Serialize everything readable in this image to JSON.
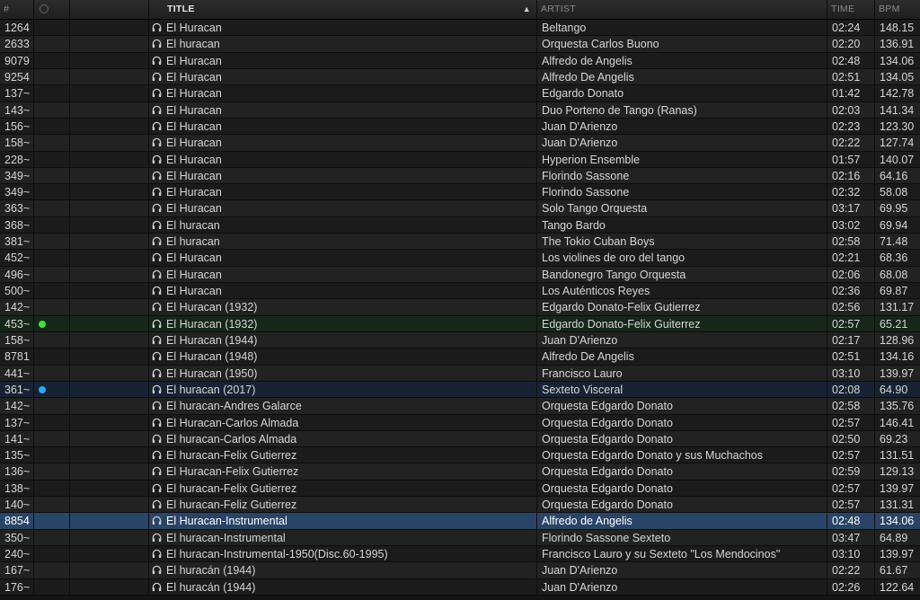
{
  "columns": {
    "num": "#",
    "title": "TITLE",
    "artist": "ARTIST",
    "time": "TIME",
    "bpm": "BPM"
  },
  "sort": {
    "column": "title",
    "direction": "ascending",
    "arrow": "▲"
  },
  "colors": {
    "green_dot": "#3fe23a",
    "blue_dot": "#27a8ee",
    "selected_row": "#2a4468"
  },
  "tracks": [
    {
      "num": "1264",
      "title": "El Huracan",
      "artist": "Beltango",
      "time": "02:24",
      "bpm": "148.15"
    },
    {
      "num": "2633",
      "title": "El huracan",
      "artist": "Orquesta Carlos Buono",
      "time": "02:20",
      "bpm": "136.91"
    },
    {
      "num": "9079",
      "title": "El Huracan",
      "artist": "Alfredo de Angelis",
      "time": "02:48",
      "bpm": "134.06"
    },
    {
      "num": "9254",
      "title": "El Huracan",
      "artist": "Alfredo De Angelis",
      "time": "02:51",
      "bpm": "134.05"
    },
    {
      "num": "137~",
      "title": "El Huracan",
      "artist": "Edgardo Donato",
      "time": "01:42",
      "bpm": "142.78"
    },
    {
      "num": "143~",
      "title": "El Huracan",
      "artist": "Duo Porteno de Tango (Ranas)",
      "time": "02:03",
      "bpm": "141.34"
    },
    {
      "num": "156~",
      "title": "El Huracan",
      "artist": "Juan D'Arienzo",
      "time": "02:23",
      "bpm": "123.30"
    },
    {
      "num": "158~",
      "title": "El Huracan",
      "artist": "Juan D'Arienzo",
      "time": "02:22",
      "bpm": "127.74"
    },
    {
      "num": "228~",
      "title": "El Huracan",
      "artist": "Hyperion Ensemble",
      "time": "01:57",
      "bpm": "140.07"
    },
    {
      "num": "349~",
      "title": "El Huracan",
      "artist": "Florindo Sassone",
      "time": "02:16",
      "bpm": "64.16"
    },
    {
      "num": "349~",
      "title": "El Huracan",
      "artist": "Florindo Sassone",
      "time": "02:32",
      "bpm": "58.08"
    },
    {
      "num": "363~",
      "title": "El Huracan",
      "artist": "Solo Tango Orquesta",
      "time": "03:17",
      "bpm": "69.95"
    },
    {
      "num": "368~",
      "title": "El huracan",
      "artist": "Tango Bardo",
      "time": "03:02",
      "bpm": "69.94"
    },
    {
      "num": "381~",
      "title": "El huracan",
      "artist": "The Tokio Cuban Boys",
      "time": "02:58",
      "bpm": "71.48"
    },
    {
      "num": "452~",
      "title": "El Huracan",
      "artist": "Los violines de oro del tango",
      "time": "02:21",
      "bpm": "68.36"
    },
    {
      "num": "496~",
      "title": "El Huracan",
      "artist": "Bandonegro Tango Orquesta",
      "time": "02:06",
      "bpm": "68.08"
    },
    {
      "num": "500~",
      "title": "El Huracan",
      "artist": "Los Auténticos Reyes",
      "time": "02:36",
      "bpm": "69.87"
    },
    {
      "num": "142~",
      "title": "El Huracan (1932)",
      "artist": "Edgardo Donato-Felix Gutierrez",
      "time": "02:56",
      "bpm": "131.17"
    },
    {
      "num": "453~",
      "title": "El Huracan (1932)",
      "artist": "Edgardo Donato-Felix Guiterrez",
      "time": "02:57",
      "bpm": "65.21",
      "marker": "green"
    },
    {
      "num": "158~",
      "title": "El Huracan (1944)",
      "artist": "Juan D'Arienzo",
      "time": "02:17",
      "bpm": "128.96"
    },
    {
      "num": "8781",
      "title": "El Huracan (1948)",
      "artist": "Alfredo De Angelis",
      "time": "02:51",
      "bpm": "134.16"
    },
    {
      "num": "441~",
      "title": "El Huracan (1950)",
      "artist": "Francisco Lauro",
      "time": "03:10",
      "bpm": "139.97"
    },
    {
      "num": "361~",
      "title": "El huracan (2017)",
      "artist": "Sexteto Visceral",
      "time": "02:08",
      "bpm": "64.90",
      "marker": "blue"
    },
    {
      "num": "142~",
      "title": "El huracan-Andres Galarce",
      "artist": "Orquesta Edgardo Donato",
      "time": "02:58",
      "bpm": "135.76"
    },
    {
      "num": "137~",
      "title": "El Huracan-Carlos Almada",
      "artist": "Orquesta Edgardo Donato",
      "time": "02:57",
      "bpm": "146.41"
    },
    {
      "num": "141~",
      "title": "El huracan-Carlos Almada",
      "artist": "Orquesta Edgardo Donato",
      "time": "02:50",
      "bpm": "69.23"
    },
    {
      "num": "135~",
      "title": "El huracan-Felix Gutierrez",
      "artist": "Orquesta Edgardo Donato y sus Muchachos",
      "time": "02:57",
      "bpm": "131.51"
    },
    {
      "num": "136~",
      "title": "El Huracan-Felix Gutierrez",
      "artist": "Orquesta Edgardo Donato",
      "time": "02:59",
      "bpm": "129.13"
    },
    {
      "num": "138~",
      "title": "El huracan-Felix Gutierrez",
      "artist": "Orquesta Edgardo Donato",
      "time": "02:57",
      "bpm": "139.97"
    },
    {
      "num": "140~",
      "title": "El huracan-Feliz Gutierrez",
      "artist": "Orquesta Edgardo Donato",
      "time": "02:57",
      "bpm": "131.31"
    },
    {
      "num": "8854",
      "title": "El Huracan-Instrumental",
      "artist": "Alfredo de Angelis",
      "time": "02:48",
      "bpm": "134.06",
      "selected": true
    },
    {
      "num": "350~",
      "title": "El huracan-Instrumental",
      "artist": "Florindo Sassone Sexteto",
      "time": "03:47",
      "bpm": "64.89"
    },
    {
      "num": "240~",
      "title": "El huracan-Instrumental-1950(Disc.60-1995)",
      "artist": "Francisco Lauro y su Sexteto \"Los Mendocinos\"",
      "time": "03:10",
      "bpm": "139.97"
    },
    {
      "num": "167~",
      "title": "El huracán (1944)",
      "artist": "Juan D'Arienzo",
      "time": "02:22",
      "bpm": "61.67"
    },
    {
      "num": "176~",
      "title": "El huracán (1944)",
      "artist": "Juan D'Arienzo",
      "time": "02:26",
      "bpm": "122.64"
    }
  ]
}
